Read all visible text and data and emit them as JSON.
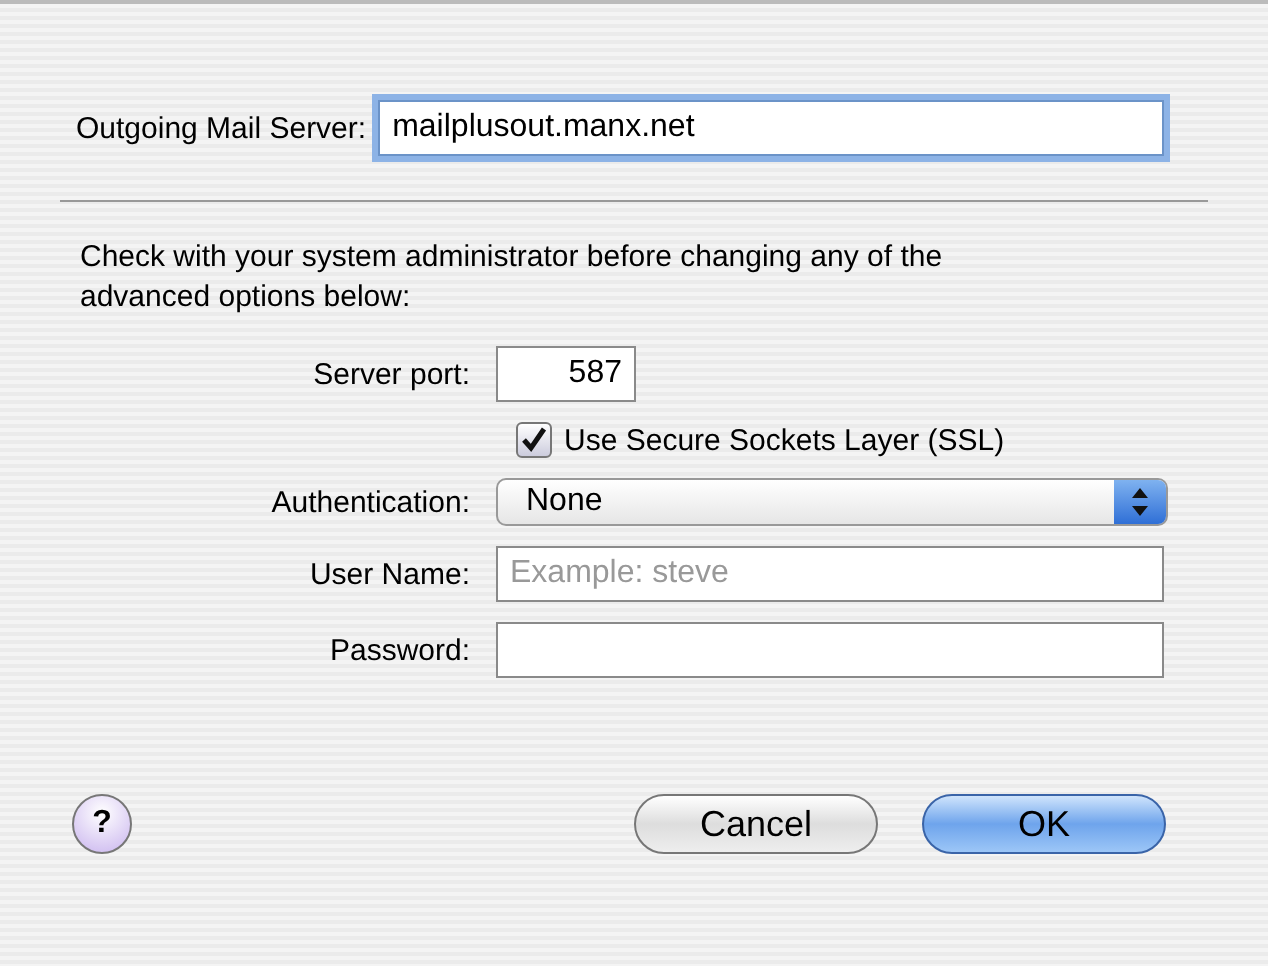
{
  "outgoing_server": {
    "label": "Outgoing Mail Server:",
    "value": "mailplusout.manx.net",
    "focused": true
  },
  "notice": "Check with your system administrator before changing any of the advanced options below:",
  "fields": [
    {
      "kind": "short_text",
      "label": "Server port:",
      "value": "587"
    },
    {
      "kind": "checkbox",
      "label": "Use Secure Sockets Layer (SSL)",
      "checked": true
    },
    {
      "kind": "popup",
      "label": "Authentication:",
      "value": "None"
    },
    {
      "kind": "text",
      "label": "User Name:",
      "placeholder": "Example: steve"
    },
    {
      "kind": "text",
      "label": "Password:"
    }
  ],
  "help_button": "?",
  "buttons": [
    {
      "label": "Cancel",
      "default": false
    },
    {
      "label": "OK",
      "default": true
    }
  ]
}
